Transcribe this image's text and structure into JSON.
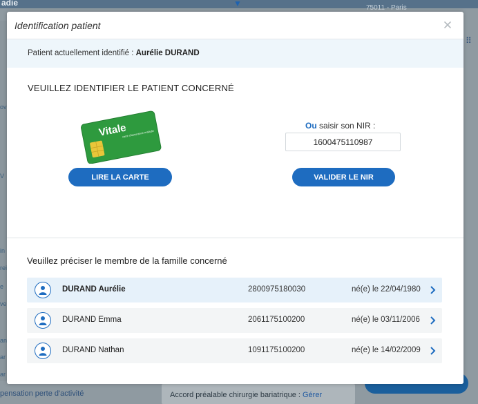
{
  "background": {
    "top_left_text": "adie",
    "top_right_text": "75011 - Paris",
    "left_labels": [
      "ov",
      "V",
      "in",
      "rei",
      "e",
      "ve",
      "ant",
      "ar",
      "ar"
    ],
    "bottom_left_text": "pensation perte d'activité",
    "bottom_mid_text": "Accord préalable chirurgie bariatrique : ",
    "bottom_mid_link": "Gérer"
  },
  "modal": {
    "title": "Identification patient",
    "current_patient_label": "Patient actuellement identifié : ",
    "current_patient_name": "Aurélie DURAND",
    "identify_title": "VEUILLEZ IDENTIFIER LE PATIENT CONCERNÉ",
    "card_logo_text": "Vitale",
    "card_subtext": "carte d'assurance maladie",
    "read_card_label": "LIRE LA CARTE",
    "nir_label_prefix": "Ou",
    "nir_label_rest": " saisir son NIR :",
    "nir_value": "1600475110987",
    "validate_label": "VALIDER LE NIR",
    "family_title": "Veuillez préciser le membre de la famille concerné",
    "members": [
      {
        "name": "DURAND Aurélie",
        "nir": "2800975180030",
        "birth": "né(e) le 22/04/1980",
        "selected": true
      },
      {
        "name": "DURAND Emma",
        "nir": "2061175100200",
        "birth": "né(e) le 03/11/2006",
        "selected": false
      },
      {
        "name": "DURAND Nathan",
        "nir": "1091175100200",
        "birth": "né(e) le 14/02/2009",
        "selected": false
      }
    ]
  },
  "colors": {
    "primary_blue": "#1e6cc0",
    "vitale_green": "#2e9a3e",
    "vitale_chip": "#e9c63a"
  }
}
